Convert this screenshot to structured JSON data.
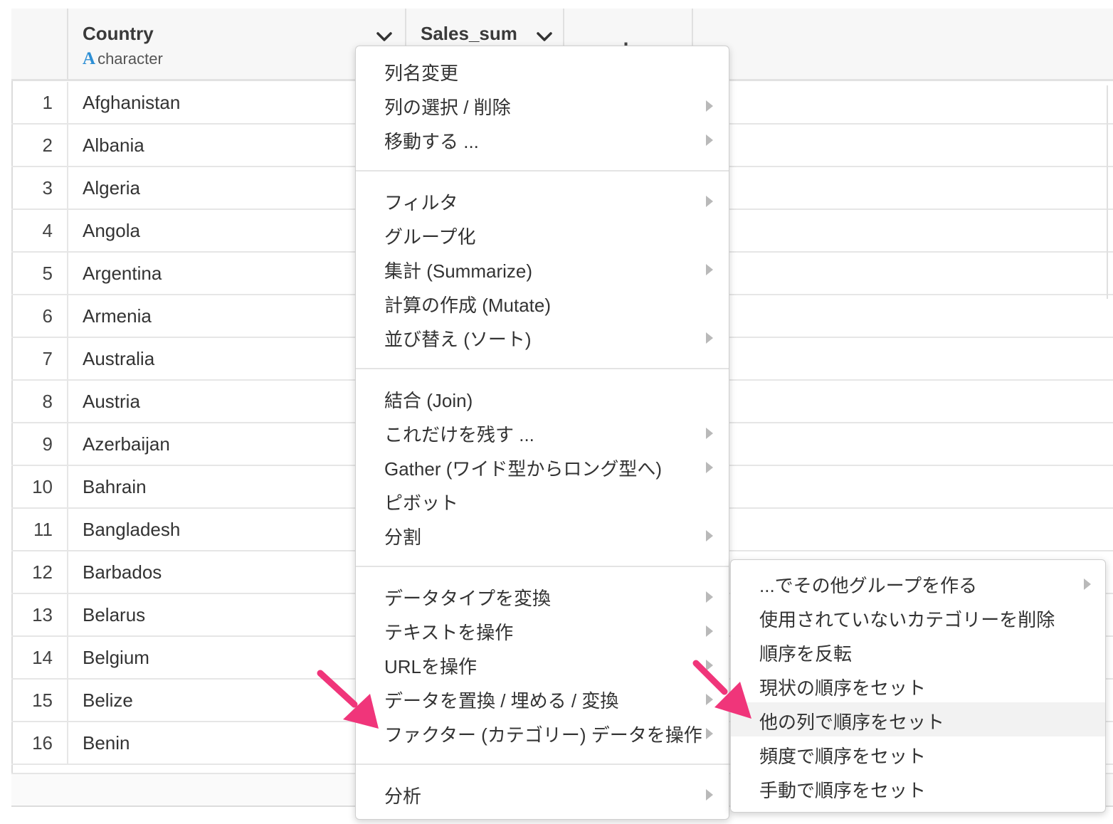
{
  "columns": [
    {
      "name": "Country",
      "type_icon": "A",
      "type": "character",
      "menu_icon": "chevron-down-icon"
    },
    {
      "name": "Sales_sum",
      "menu_icon": "chevron-down-icon"
    }
  ],
  "add_column": {
    "label": "+"
  },
  "rows": [
    {
      "index": "1",
      "country": "Afghanistan"
    },
    {
      "index": "2",
      "country": "Albania"
    },
    {
      "index": "3",
      "country": "Algeria"
    },
    {
      "index": "4",
      "country": "Angola"
    },
    {
      "index": "5",
      "country": "Argentina"
    },
    {
      "index": "6",
      "country": "Armenia"
    },
    {
      "index": "7",
      "country": "Australia"
    },
    {
      "index": "8",
      "country": "Austria"
    },
    {
      "index": "9",
      "country": "Azerbaijan"
    },
    {
      "index": "10",
      "country": "Bahrain"
    },
    {
      "index": "11",
      "country": "Bangladesh"
    },
    {
      "index": "12",
      "country": "Barbados"
    },
    {
      "index": "13",
      "country": "Belarus"
    },
    {
      "index": "14",
      "country": "Belgium"
    },
    {
      "index": "15",
      "country": "Belize"
    },
    {
      "index": "16",
      "country": "Benin"
    }
  ],
  "column_menu": {
    "groups": [
      [
        {
          "label": "列名変更",
          "submenu": false
        },
        {
          "label": "列の選択 / 削除",
          "submenu": true
        },
        {
          "label": "移動する ...",
          "submenu": true
        }
      ],
      [
        {
          "label": "フィルタ",
          "submenu": true
        },
        {
          "label": "グループ化",
          "submenu": false
        },
        {
          "label": "集計 (Summarize)",
          "submenu": true
        },
        {
          "label": "計算の作成 (Mutate)",
          "submenu": false
        },
        {
          "label": "並び替え (ソート)",
          "submenu": true
        }
      ],
      [
        {
          "label": "結合 (Join)",
          "submenu": false
        },
        {
          "label": "これだけを残す ...",
          "submenu": true
        },
        {
          "label": "Gather (ワイド型からロング型へ)",
          "submenu": true
        },
        {
          "label": "ピボット",
          "submenu": false
        },
        {
          "label": "分割",
          "submenu": true
        }
      ],
      [
        {
          "label": "データタイプを変換",
          "submenu": true
        },
        {
          "label": "テキストを操作",
          "submenu": true
        },
        {
          "label": "URLを操作",
          "submenu": true
        },
        {
          "label": "データを置換 / 埋める / 変換",
          "submenu": true
        },
        {
          "label": "ファクター (カテゴリー) データを操作",
          "submenu": true
        }
      ],
      [
        {
          "label": "分析",
          "submenu": true
        }
      ]
    ]
  },
  "factor_submenu": {
    "items": [
      {
        "label": "...でその他グループを作る",
        "submenu": true,
        "highlighted": false
      },
      {
        "label": "使用されていないカテゴリーを削除",
        "submenu": false,
        "highlighted": false
      },
      {
        "label": "順序を反転",
        "submenu": false,
        "highlighted": false
      },
      {
        "label": "現状の順序をセット",
        "submenu": false,
        "highlighted": false
      },
      {
        "label": "他の列で順序をセット",
        "submenu": false,
        "highlighted": true
      },
      {
        "label": "頻度で順序をセット",
        "submenu": false,
        "highlighted": false
      },
      {
        "label": "手動で順序をセット",
        "submenu": false,
        "highlighted": false
      }
    ]
  },
  "colors": {
    "annotation_arrow": "#f0357a",
    "type_icon": "#2d8fd5",
    "highlight_bg": "#f2f2f2"
  }
}
